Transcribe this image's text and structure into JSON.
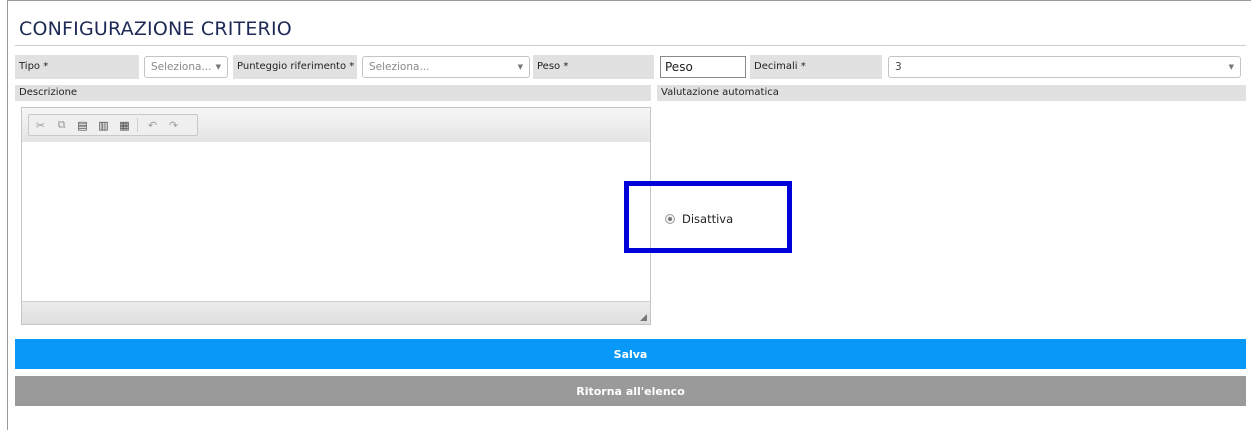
{
  "page": {
    "title": "CONFIGURAZIONE CRITERIO"
  },
  "form": {
    "tipo_label": "Tipo *",
    "tipo_value": "Seleziona...",
    "punteggio_label": "Punteggio riferimento *",
    "punteggio_value": "Seleziona...",
    "peso_label": "Peso *",
    "peso_value": "Peso",
    "decimali_label": "Decimali *",
    "decimali_value": "3",
    "descrizione_label": "Descrizione",
    "valutazione_label": "Valutazione automatica",
    "valutazione_option": "Disattiva"
  },
  "editor_toolbar": [
    "cut-icon",
    "copy-icon",
    "paste-icon",
    "paste-text-icon",
    "paste-word-icon",
    "undo-icon",
    "redo-icon"
  ],
  "buttons": {
    "save": "Salva",
    "back": "Ritorna all'elenco"
  },
  "colors": {
    "save": "#0898f8",
    "back": "#9a9a9a",
    "highlight": "#0000d8",
    "title": "#1e2a55"
  }
}
